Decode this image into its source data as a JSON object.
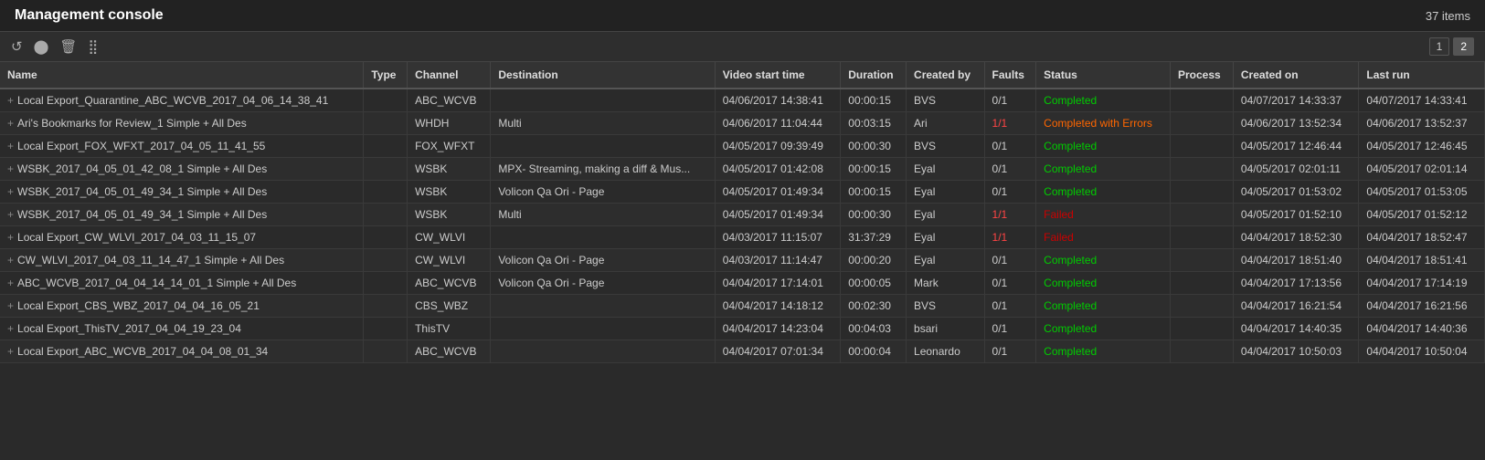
{
  "header": {
    "title": "Management console",
    "item_count": "37 items"
  },
  "toolbar": {
    "icons": [
      {
        "name": "recycle-icon",
        "symbol": "↺"
      },
      {
        "name": "stop-icon",
        "symbol": "●"
      },
      {
        "name": "delete-icon",
        "symbol": "🗑"
      },
      {
        "name": "menu-icon",
        "symbol": "≡"
      }
    ]
  },
  "pagination": {
    "pages": [
      "1",
      "2"
    ],
    "active": "2"
  },
  "table": {
    "columns": [
      "Name",
      "Type",
      "Channel",
      "Destination",
      "Video start time",
      "Duration",
      "Created by",
      "Faults",
      "Status",
      "Process",
      "Created on",
      "Last run"
    ],
    "rows": [
      {
        "name": "Local Export_Quarantine_ABC_WCVB_2017_04_06_14_38_41",
        "type": "",
        "channel": "ABC_WCVB",
        "destination": "",
        "video_start": "04/06/2017 14:38:41",
        "duration": "00:00:15",
        "created_by": "BVS",
        "faults": "0/1",
        "status": "Completed",
        "status_class": "status-completed",
        "process": "",
        "created_on": "04/07/2017 14:33:37",
        "last_run": "04/07/2017 14:33:41",
        "faults_class": "faults-ok"
      },
      {
        "name": "Ari's Bookmarks for Review_1 Simple + All Des",
        "type": "",
        "channel": "WHDH",
        "destination": "Multi",
        "video_start": "04/06/2017 11:04:44",
        "duration": "00:03:15",
        "created_by": "Ari",
        "faults": "1/1",
        "status": "Completed with Errors",
        "status_class": "status-error",
        "process": "",
        "created_on": "04/06/2017 13:52:34",
        "last_run": "04/06/2017 13:52:37",
        "faults_class": "faults-error"
      },
      {
        "name": "Local Export_FOX_WFXT_2017_04_05_11_41_55",
        "type": "",
        "channel": "FOX_WFXT",
        "destination": "",
        "video_start": "04/05/2017 09:39:49",
        "duration": "00:00:30",
        "created_by": "BVS",
        "faults": "0/1",
        "status": "Completed",
        "status_class": "status-completed",
        "process": "",
        "created_on": "04/05/2017 12:46:44",
        "last_run": "04/05/2017 12:46:45",
        "faults_class": "faults-ok"
      },
      {
        "name": "WSBK_2017_04_05_01_42_08_1 Simple + All Des",
        "type": "",
        "channel": "WSBK",
        "destination": "MPX- Streaming, making a diff & Mus...",
        "video_start": "04/05/2017 01:42:08",
        "duration": "00:00:15",
        "created_by": "Eyal",
        "faults": "0/1",
        "status": "Completed",
        "status_class": "status-completed",
        "process": "",
        "created_on": "04/05/2017 02:01:11",
        "last_run": "04/05/2017 02:01:14",
        "faults_class": "faults-ok"
      },
      {
        "name": "WSBK_2017_04_05_01_49_34_1 Simple + All Des",
        "type": "",
        "channel": "WSBK",
        "destination": "Volicon Qa Ori - Page",
        "video_start": "04/05/2017 01:49:34",
        "duration": "00:00:15",
        "created_by": "Eyal",
        "faults": "0/1",
        "status": "Completed",
        "status_class": "status-completed",
        "process": "",
        "created_on": "04/05/2017 01:53:02",
        "last_run": "04/05/2017 01:53:05",
        "faults_class": "faults-ok"
      },
      {
        "name": "WSBK_2017_04_05_01_49_34_1 Simple + All Des",
        "type": "",
        "channel": "WSBK",
        "destination": "Multi",
        "video_start": "04/05/2017 01:49:34",
        "duration": "00:00:30",
        "created_by": "Eyal",
        "faults": "1/1",
        "status": "Failed",
        "status_class": "status-failed",
        "process": "",
        "created_on": "04/05/2017 01:52:10",
        "last_run": "04/05/2017 01:52:12",
        "faults_class": "faults-error"
      },
      {
        "name": "Local Export_CW_WLVI_2017_04_03_11_15_07",
        "type": "",
        "channel": "CW_WLVI",
        "destination": "",
        "video_start": "04/03/2017 11:15:07",
        "duration": "31:37:29",
        "created_by": "Eyal",
        "faults": "1/1",
        "status": "Failed",
        "status_class": "status-failed",
        "process": "",
        "created_on": "04/04/2017 18:52:30",
        "last_run": "04/04/2017 18:52:47",
        "faults_class": "faults-error"
      },
      {
        "name": "CW_WLVI_2017_04_03_11_14_47_1 Simple + All Des",
        "type": "",
        "channel": "CW_WLVI",
        "destination": "Volicon Qa Ori - Page",
        "video_start": "04/03/2017 11:14:47",
        "duration": "00:00:20",
        "created_by": "Eyal",
        "faults": "0/1",
        "status": "Completed",
        "status_class": "status-completed",
        "process": "",
        "created_on": "04/04/2017 18:51:40",
        "last_run": "04/04/2017 18:51:41",
        "faults_class": "faults-ok"
      },
      {
        "name": "ABC_WCVB_2017_04_04_14_14_01_1 Simple + All Des",
        "type": "",
        "channel": "ABC_WCVB",
        "destination": "Volicon Qa Ori - Page",
        "video_start": "04/04/2017 17:14:01",
        "duration": "00:00:05",
        "created_by": "Mark",
        "faults": "0/1",
        "status": "Completed",
        "status_class": "status-completed",
        "process": "",
        "created_on": "04/04/2017 17:13:56",
        "last_run": "04/04/2017 17:14:19",
        "faults_class": "faults-ok"
      },
      {
        "name": "Local Export_CBS_WBZ_2017_04_04_16_05_21",
        "type": "",
        "channel": "CBS_WBZ",
        "destination": "",
        "video_start": "04/04/2017 14:18:12",
        "duration": "00:02:30",
        "created_by": "BVS",
        "faults": "0/1",
        "status": "Completed",
        "status_class": "status-completed",
        "process": "",
        "created_on": "04/04/2017 16:21:54",
        "last_run": "04/04/2017 16:21:56",
        "faults_class": "faults-ok"
      },
      {
        "name": "Local Export_ThisTV_2017_04_04_19_23_04",
        "type": "",
        "channel": "ThisTV",
        "destination": "",
        "video_start": "04/04/2017 14:23:04",
        "duration": "00:04:03",
        "created_by": "bsari",
        "faults": "0/1",
        "status": "Completed",
        "status_class": "status-completed",
        "process": "",
        "created_on": "04/04/2017 14:40:35",
        "last_run": "04/04/2017 14:40:36",
        "faults_class": "faults-ok"
      },
      {
        "name": "Local Export_ABC_WCVB_2017_04_04_08_01_34",
        "type": "",
        "channel": "ABC_WCVB",
        "destination": "",
        "video_start": "04/04/2017 07:01:34",
        "duration": "00:00:04",
        "created_by": "Leonardo",
        "faults": "0/1",
        "status": "Completed",
        "status_class": "status-completed",
        "process": "",
        "created_on": "04/04/2017 10:50:03",
        "last_run": "04/04/2017 10:50:04",
        "faults_class": "faults-ok"
      }
    ]
  }
}
